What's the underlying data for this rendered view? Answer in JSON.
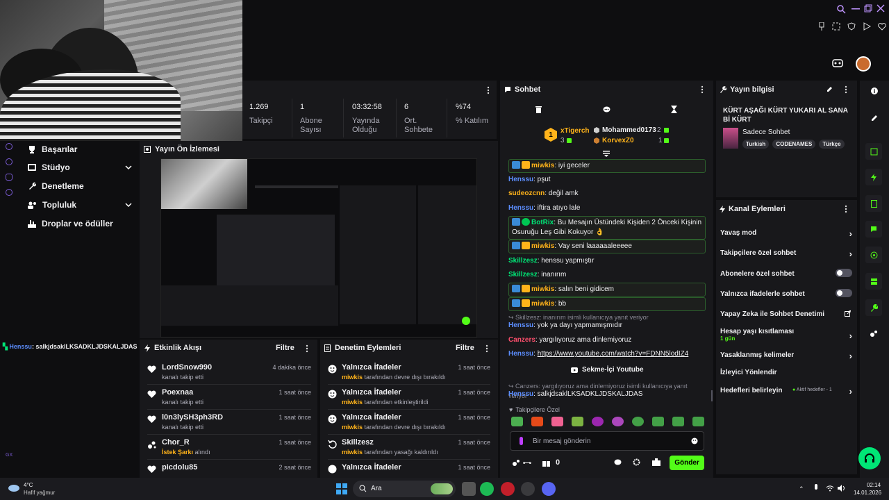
{
  "stats": [
    {
      "value": "1.269",
      "label": "Takipçi"
    },
    {
      "value": "1",
      "label": "Abone Sayısı"
    },
    {
      "value": "03:32:58",
      "label": "Yayında Olduğu"
    },
    {
      "value": "6",
      "label": "Ort. Sohbete"
    },
    {
      "value": "%74",
      "label": "% Katılım"
    }
  ],
  "nav": {
    "items": [
      {
        "label": "Başarılar"
      },
      {
        "label": "Stüdyo"
      },
      {
        "label": "Denetleme"
      },
      {
        "label": "Topluluk"
      },
      {
        "label": "Droplar ve ödüller"
      }
    ],
    "footer_label": "GX"
  },
  "preview": {
    "title": "Yayın Ön İzlemesi"
  },
  "left_chat_line": {
    "user": "Henssu",
    "text": ": salkjdsaklLKSADKLJDSKALJDAS"
  },
  "activity": {
    "title": "Etkinlik Akışı",
    "filter": "Filtre",
    "rows": [
      {
        "name": "LordSnow990",
        "sub": "kanalı takip etti",
        "time": "4 dakika önce",
        "icon": "heart-icon"
      },
      {
        "name": "Poexnaa",
        "sub": "kanalı takip etti",
        "time": "1 saat önce",
        "icon": "heart-icon"
      },
      {
        "name": "l0n3lySH3ph3RD",
        "sub": "kanalı takip etti",
        "time": "1 saat önce",
        "icon": "heart-icon"
      },
      {
        "name": "Chor_R",
        "sub_prefix": "İstek Şarkı",
        "sub": "alındı",
        "time": "1 saat önce",
        "icon": "points-icon"
      },
      {
        "name": "picdolu85",
        "sub": "",
        "time": "2 saat önce",
        "icon": "heart-icon"
      }
    ]
  },
  "mod_actions": {
    "title": "Denetim Eylemleri",
    "filter": "Filtre",
    "rows": [
      {
        "name": "Yalnızca İfadeler",
        "user": "miwkis",
        "sub": "tarafından devre dışı bırakıldı",
        "time": "1 saat önce"
      },
      {
        "name": "Yalnızca İfadeler",
        "user": "miwkis",
        "sub": "tarafından etkinleştirildi",
        "time": "1 saat önce"
      },
      {
        "name": "Yalnızca İfadeler",
        "user": "miwkis",
        "sub": "tarafından devre dışı bırakıldı",
        "time": "1 saat önce"
      },
      {
        "name": "Skillzesz",
        "user": "miwkis",
        "sub": "tarafından yasağı kaldırıldı",
        "time": "1 saat önce"
      },
      {
        "name": "Yalnızca İfadeler",
        "user": "",
        "sub": "",
        "time": "1 saat önce"
      }
    ]
  },
  "chat": {
    "title": "Sohbet",
    "leaderboard": {
      "first": {
        "rank": "1",
        "name": "xTigerch",
        "score": "3"
      },
      "second": {
        "name": "Mohammed0173",
        "score": "2"
      },
      "third": {
        "name": "KorvexZ0",
        "score": "1"
      }
    },
    "messages": [
      {
        "user": "miwkis",
        "text": ": iyi geceler",
        "color": "#ffb31a",
        "badges": true,
        "hl": true
      },
      {
        "user": "Henssu",
        "text": ": pşut",
        "color": "#5c8eff"
      },
      {
        "user": "sudeozcnn",
        "text": ": değil amk",
        "color": "#ffb31a"
      },
      {
        "user": "Henssu",
        "text": ": iftira atıyo lale",
        "color": "#5c8eff"
      },
      {
        "user": "BotRix",
        "text": ": Bu Mesajın Üstündeki Kişiden 2 Önceki Kişinin Osuruğu Leş Gibi Kokuyor 👌",
        "color": "#00e676",
        "badges": true,
        "hl": true
      },
      {
        "user": "miwkis",
        "text": ": Vay seni laaaaaaleeeee",
        "color": "#ffb31a",
        "badges": true,
        "hl": true
      },
      {
        "user": "Skillzesz",
        "text": ": henssu yapmıştır",
        "color": "#00e676"
      },
      {
        "user": "Skillzesz",
        "text": ": inanırım",
        "color": "#00e676"
      },
      {
        "user": "miwkis",
        "text": ": salın beni gidicem",
        "color": "#ffb31a",
        "badges": true,
        "hl": true
      },
      {
        "user": "miwkis",
        "text": ": bb",
        "color": "#ffb31a",
        "badges": true,
        "hl": true
      }
    ],
    "reply1": "Skillzesz: inanırım isimli kullanıcıya yanıt veriyor",
    "msg_after_reply1": {
      "user": "Henssu",
      "text": ": yok ya dayı yapmamışmıdır"
    },
    "msg_canzers": {
      "user": "Canzers",
      "text": ": yargılıyoruz ama dinlemiyoruz"
    },
    "msg_link": {
      "user": "Henssu",
      "prefix": ": ",
      "link": "https://www.youtube.com/watch?v=FDNN5lodIZ4"
    },
    "youtube_button": "Sekme-İçi Youtube",
    "reply2": "Canzers: yargılıyoruz ama dinlemiyoruz isimli kullanıcıya yanıt veriyor",
    "msg_last": {
      "user": "Henssu",
      "text": ": salkjdsaklLKSADKLJDSKALJDAS"
    },
    "emote_section": "Takipçilere Özel",
    "input_placeholder": "Bir mesaj gönderin",
    "points": "0",
    "send": "Gönder"
  },
  "stream_info": {
    "title": "Yayın bilgisi",
    "stream_title": "KÜRT AŞAĞI KÜRT YUKARI AL SANA Bİ KÜRT",
    "category": "Sadece Sohbet",
    "tags": [
      "Turkish",
      "CODENAMES",
      "Türkçe"
    ]
  },
  "channel_actions": {
    "title": "Kanal Eylemleri",
    "items": [
      {
        "label": "Yavaş mod",
        "control": "chevron"
      },
      {
        "label": "Takipçilere özel sohbet",
        "control": "chevron"
      },
      {
        "label": "Abonelere özel sohbet",
        "control": "toggle"
      },
      {
        "label": "Yalnızca ifadelerle sohbet",
        "control": "toggle"
      },
      {
        "label": "Yapay Zeka ile Sohbet Denetimi",
        "control": "external"
      },
      {
        "label": "Hesap yaşı kısıtlaması",
        "sub": "1 gün",
        "control": "chevron"
      },
      {
        "label": "Yasaklanmış kelimeler",
        "control": "chevron"
      },
      {
        "label": "İzleyici Yönlendir",
        "control": "none"
      },
      {
        "label": "Hedefleri belirleyin",
        "extra": "Aktif hedefler - 1",
        "control": "chevron"
      }
    ]
  },
  "taskbar": {
    "weather_temp": "4°C",
    "weather_desc": "Hafif yağmur",
    "search": "Ara",
    "time": "02:14",
    "date": "14.01.2026"
  },
  "colors": {
    "accent": "#53fc18",
    "purple": "#bf94ff",
    "gold": "#ffb31a"
  }
}
